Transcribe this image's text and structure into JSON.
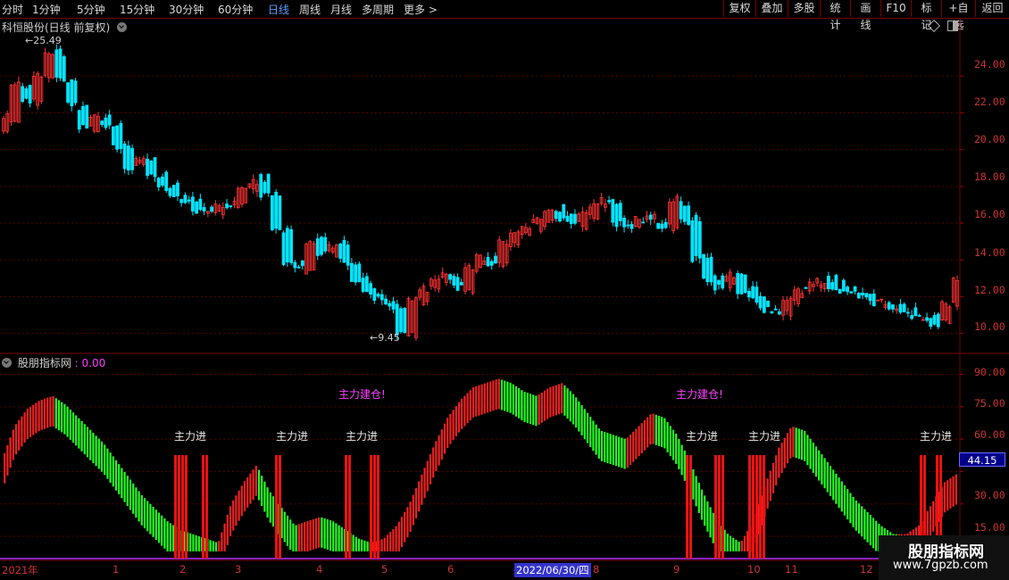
{
  "toolbar": {
    "periods": [
      "分时",
      "1分钟",
      "5分钟",
      "15分钟",
      "30分钟",
      "60分钟",
      "日线",
      "周线",
      "月线",
      "多周期",
      "更多 >"
    ],
    "active_period": "日线",
    "actions": [
      "复权",
      "叠加",
      "多股",
      "统计",
      "画线",
      "F10",
      "标记",
      "+自选",
      "返回"
    ]
  },
  "main_panel": {
    "title": "科恒股份(日线 前复权)",
    "high_label": "25.49",
    "low_label": "9.45",
    "y_ticks": [
      "24.00",
      "22.00",
      "20.00",
      "18.00",
      "16.00",
      "14.00",
      "12.00",
      "10.00"
    ]
  },
  "indicator_panel": {
    "title": "股朋指标网",
    "value": ": 0.00",
    "y_ticks": [
      "90.00",
      "75.00",
      "60.00",
      "45.00",
      "30.00",
      "15.00"
    ],
    "current_value": "44.15",
    "signal_label": "主力进",
    "build_label": "主力建仓!"
  },
  "time_axis": {
    "months": [
      "2021年",
      "1",
      "2",
      "3",
      "4",
      "5",
      "6",
      "8",
      "9",
      "10",
      "11",
      "12"
    ],
    "cursor_date": "2022/06/30/四"
  },
  "watermark": {
    "name": "股朋指标网",
    "url": "www.7gpzb.com"
  },
  "colors": {
    "up": "#ff3333",
    "down": "#00e5ff",
    "grid": "#5a0000",
    "osc_up": "#ee2222",
    "osc_down": "#22ff22",
    "signal_bar": "#ee1111"
  },
  "chart_data": [
    {
      "type": "candlestick",
      "title": "科恒股份(日线 前复权)",
      "ylim": [
        9.2,
        26.2
      ],
      "annotations": [
        {
          "label": "25.49",
          "value": 25.49
        },
        {
          "label": "9.45",
          "value": 9.45
        }
      ],
      "closes": [
        21.8,
        23.5,
        22.6,
        24.1,
        25.2,
        23.8,
        22.4,
        21.3,
        21.9,
        21.4,
        20.1,
        18.9,
        19.4,
        18.6,
        17.9,
        17.5,
        17.3,
        16.7,
        16.6,
        16.9,
        17.0,
        17.9,
        18.3,
        17.6,
        15.7,
        13.9,
        13.6,
        14.9,
        14.4,
        14.8,
        13.9,
        12.9,
        12.2,
        11.9,
        11.4,
        10.1,
        11.9,
        12.4,
        12.8,
        13.1,
        12.5,
        13.6,
        14.1,
        13.7,
        14.9,
        15.4,
        15.8,
        16.1,
        16.7,
        16.3,
        15.9,
        16.6,
        17.0,
        17.2,
        16.0,
        15.9,
        16.2,
        16.3,
        15.6,
        17.3,
        16.1,
        14.1,
        12.9,
        12.5,
        13.2,
        12.3,
        11.8,
        11.3,
        11.1,
        11.8,
        12.3,
        12.6,
        12.8,
        12.5,
        12.3,
        12.1,
        11.9,
        11.7,
        11.4,
        11.2,
        11.0,
        10.8,
        10.5,
        11.6,
        12.9
      ]
    },
    {
      "type": "histogram",
      "title": "股朋指标网",
      "ylim": [
        8,
        96
      ],
      "values": [
        50,
        66,
        74,
        78,
        80,
        76,
        70,
        64,
        58,
        50,
        42,
        34,
        28,
        22,
        18,
        16,
        14,
        12,
        30,
        40,
        48,
        36,
        28,
        20,
        22,
        24,
        22,
        18,
        14,
        12,
        14,
        20,
        30,
        44,
        58,
        70,
        78,
        84,
        86,
        88,
        86,
        82,
        80,
        84,
        86,
        80,
        72,
        64,
        62,
        60,
        66,
        72,
        70,
        62,
        50,
        36,
        24,
        16,
        12,
        22,
        40,
        56,
        66,
        64,
        56,
        48,
        40,
        32,
        26,
        20,
        16,
        16,
        20,
        30,
        40,
        44
      ]
    }
  ]
}
